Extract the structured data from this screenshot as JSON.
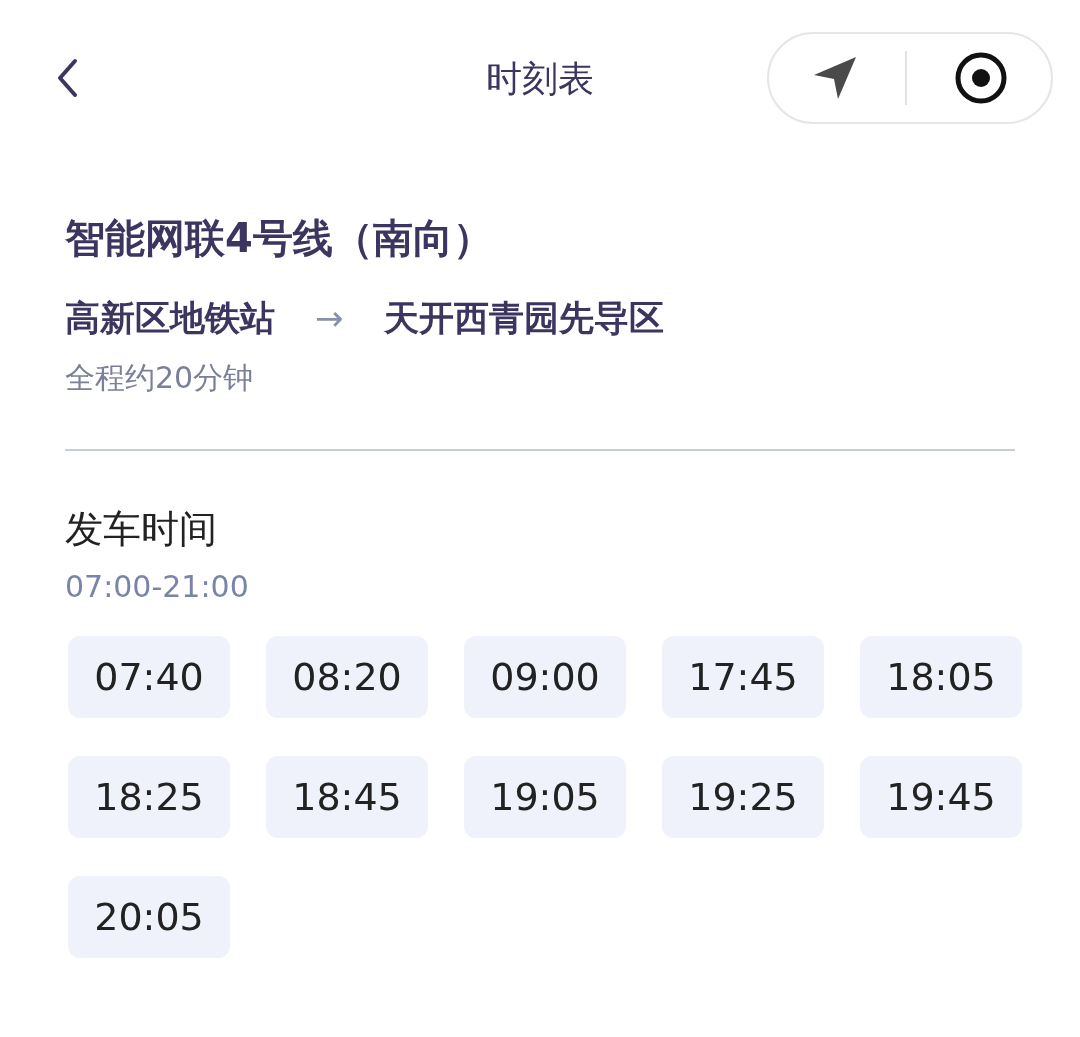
{
  "header": {
    "title": "时刻表"
  },
  "line": {
    "name": "智能网联4号线（南向）",
    "from": "高新区地铁站",
    "arrow": "→",
    "to": "天开西青园先导区",
    "duration": "全程约20分钟"
  },
  "departures": {
    "heading": "发车时间",
    "range": "07:00-21:00",
    "times": [
      "07:40",
      "08:20",
      "09:00",
      "17:45",
      "18:05",
      "18:25",
      "18:45",
      "19:05",
      "19:25",
      "19:45",
      "20:05"
    ]
  }
}
